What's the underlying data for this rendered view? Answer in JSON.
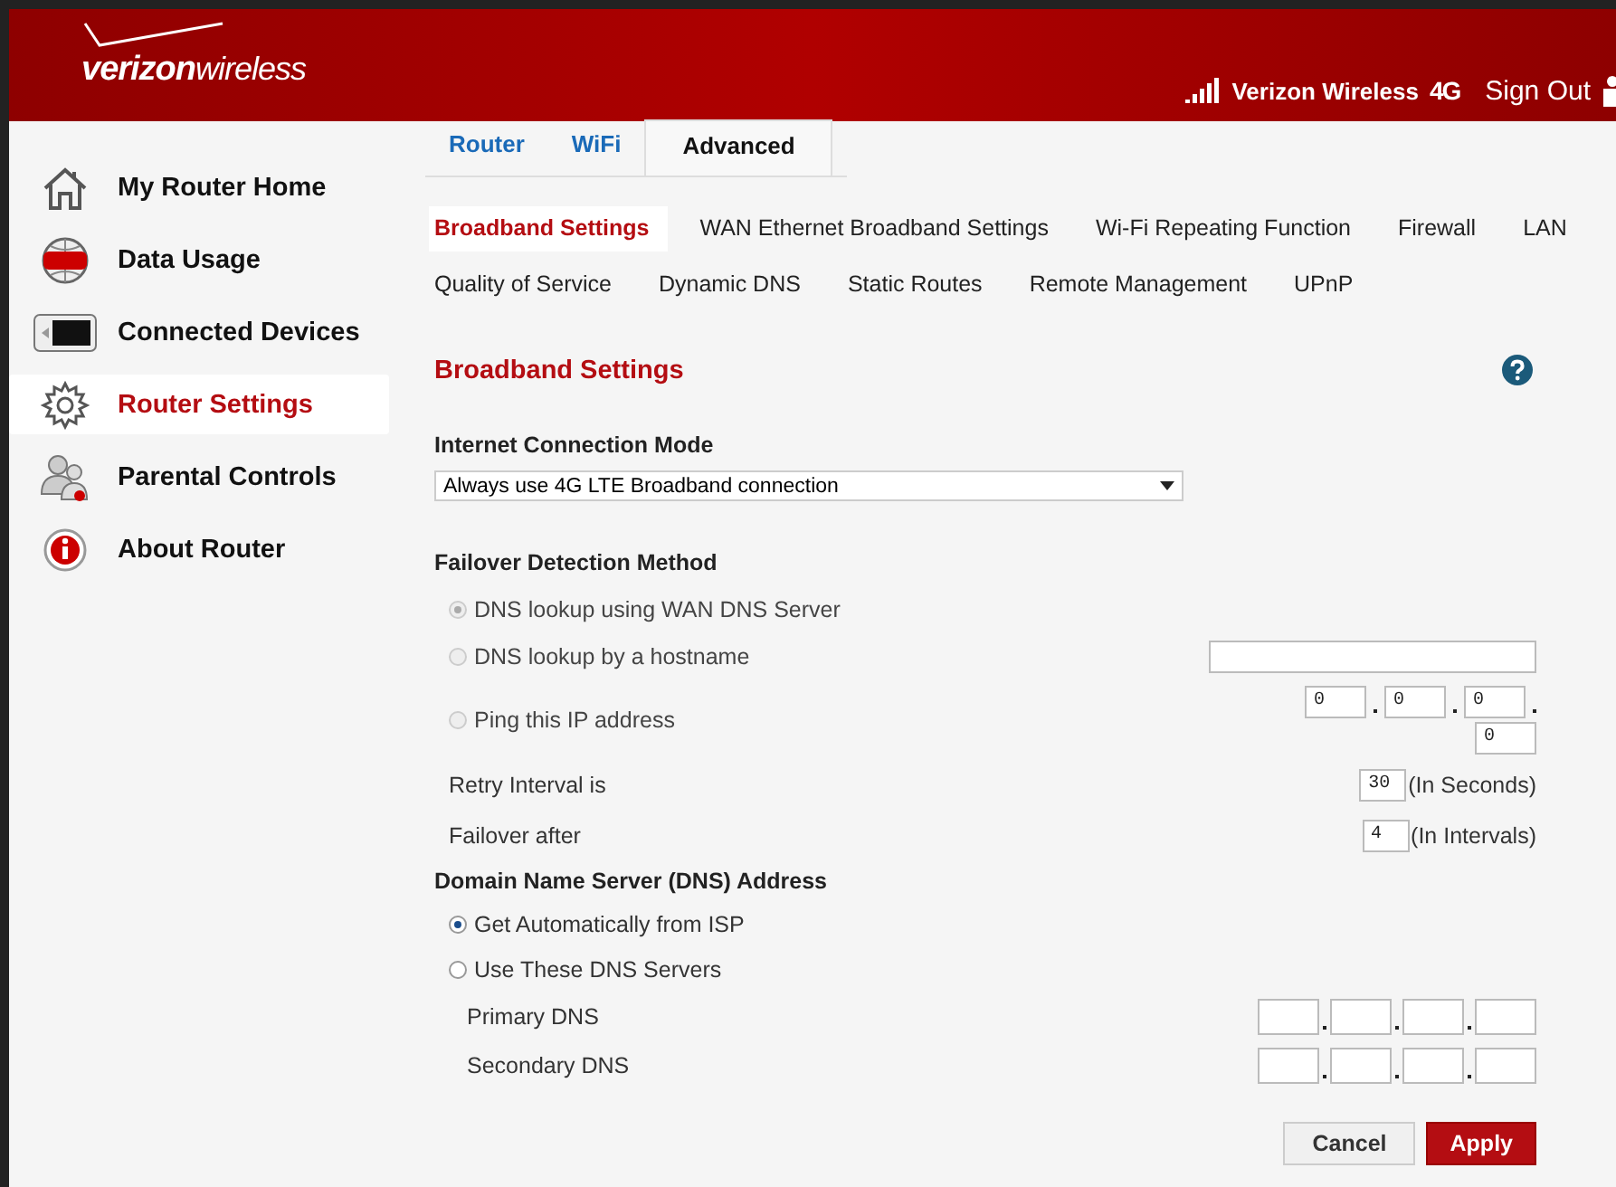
{
  "header": {
    "logo": {
      "brand": "verizon",
      "suffix": "wireless"
    },
    "carrier": "Verizon Wireless",
    "network": "4G",
    "sign_out": "Sign Out"
  },
  "sidebar": {
    "items": [
      {
        "label": "My Router Home",
        "kind": "home",
        "selected": false
      },
      {
        "label": "Data Usage",
        "kind": "data",
        "selected": false
      },
      {
        "label": "Connected Devices",
        "kind": "devices",
        "selected": false
      },
      {
        "label": "Router Settings",
        "kind": "settings",
        "selected": true
      },
      {
        "label": "Parental Controls",
        "kind": "parental",
        "selected": false
      },
      {
        "label": "About Router",
        "kind": "about",
        "selected": false
      }
    ]
  },
  "tabs": [
    {
      "label": "Router",
      "selected": false
    },
    {
      "label": "WiFi",
      "selected": false
    },
    {
      "label": "Advanced",
      "selected": true
    }
  ],
  "subtabs": [
    [
      {
        "label": "Broadband Settings",
        "selected": true
      },
      {
        "label": "WAN Ethernet Broadband Settings",
        "selected": false
      },
      {
        "label": "Wi-Fi Repeating Function",
        "selected": false
      },
      {
        "label": "Firewall",
        "selected": false
      },
      {
        "label": "LAN",
        "selected": false
      }
    ],
    [
      {
        "label": "Quality of Service",
        "selected": false
      },
      {
        "label": "Dynamic DNS",
        "selected": false
      },
      {
        "label": "Static Routes",
        "selected": false
      },
      {
        "label": "Remote Management",
        "selected": false
      },
      {
        "label": "UPnP",
        "selected": false
      }
    ]
  ],
  "section_title": "Broadband Settings",
  "connection_mode": {
    "label": "Internet Connection Mode",
    "value": "Always use 4G LTE Broadband connection"
  },
  "failover": {
    "title": "Failover Detection Method",
    "options": [
      {
        "label": "DNS lookup using WAN DNS Server",
        "selected": true,
        "disabled": true,
        "kind": "plain"
      },
      {
        "label": "DNS lookup by a hostname",
        "selected": false,
        "disabled": true,
        "kind": "hostname"
      },
      {
        "label": "Ping this IP address",
        "selected": false,
        "disabled": true,
        "kind": "ip",
        "octets": [
          "0",
          "0",
          "0",
          "0"
        ]
      }
    ],
    "retry": {
      "label": "Retry Interval is",
      "value": "30",
      "unit": "(In Seconds)"
    },
    "after": {
      "label": "Failover after",
      "value": "4",
      "unit": "(In  Intervals)"
    }
  },
  "dns": {
    "title": "Domain Name Server (DNS) Address",
    "options": [
      {
        "label": "Get Automatically from ISP",
        "selected": true,
        "disabled": false
      },
      {
        "label": "Use These DNS Servers",
        "selected": false,
        "disabled": false
      }
    ],
    "servers": [
      {
        "label": "Primary DNS"
      },
      {
        "label": "Secondary DNS"
      }
    ]
  },
  "buttons": [
    {
      "label": "Cancel",
      "kind": "secondary"
    },
    {
      "label": "Apply",
      "kind": "primary"
    }
  ]
}
